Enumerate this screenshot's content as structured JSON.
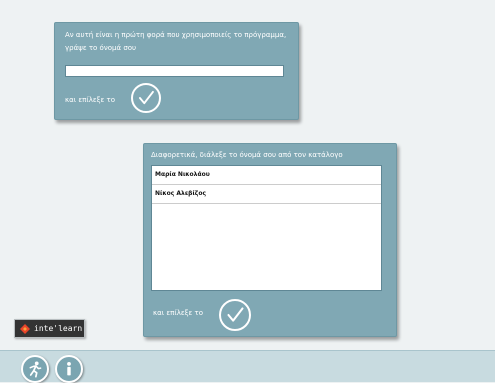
{
  "new_user": {
    "prompt": "Αν αυτή είναι η πρώτη φορά που χρησιμοποιείς το πρόγραμμα, γράψε το όνομά σου",
    "name_value": "",
    "confirm_label": "και επίλεξε το",
    "confirm_icon": "checkmark-circle-icon"
  },
  "existing_user": {
    "prompt": "Διαφορετικά, διάλεξε το όνομά σου από τον κατάλογο",
    "users": [
      "Μαρία Νικολάου",
      "Νίκος Αλεβίζος"
    ],
    "confirm_label": "και επίλεξε το",
    "confirm_icon": "checkmark-circle-icon"
  },
  "branding": {
    "logo_text": "inte'learn"
  },
  "toolbar": {
    "exit_icon": "running-person-icon",
    "info_icon": "info-icon"
  },
  "colors": {
    "panel": "#80a8b4",
    "background": "#eef2f3",
    "bar": "#c8dbe0",
    "logo_red": "#e8452b"
  }
}
